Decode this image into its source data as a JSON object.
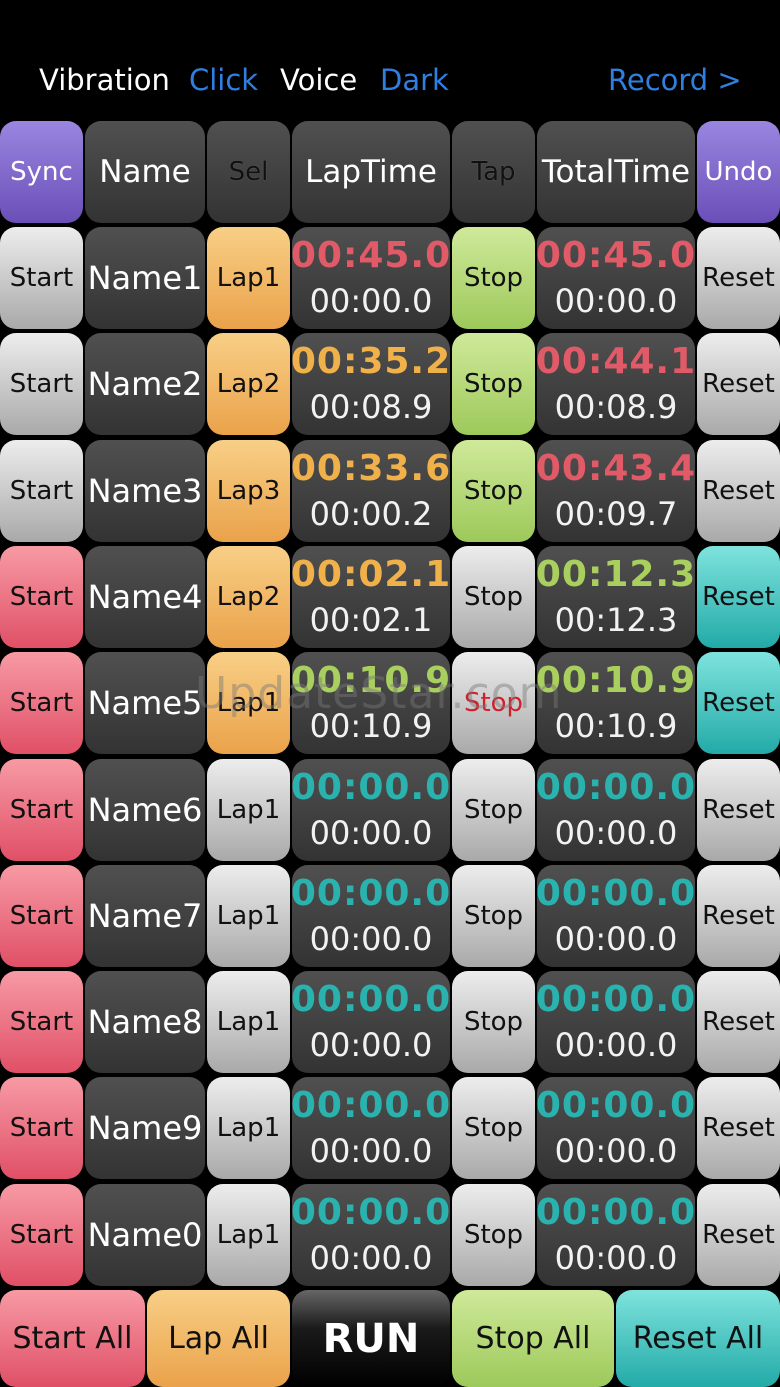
{
  "topbar": {
    "vibration": "Vibration",
    "click": "Click",
    "voice": "Voice",
    "dark": "Dark",
    "record": "Record >"
  },
  "header": {
    "sync": "Sync",
    "name": "Name",
    "sel": "Sel",
    "laptime": "LapTime",
    "tap": "Tap",
    "totaltime": "TotalTime",
    "undo": "Undo"
  },
  "colors": {
    "red_time": "#e05a68",
    "orange_time": "#f0b14a",
    "green_time": "#a9cf5e",
    "teal_time": "#2ab3ae",
    "link_blue": "#2f7fe0",
    "stop_red_text": "#d0202c"
  },
  "rows": [
    {
      "start": "Start",
      "name": "Name1",
      "lap": "Lap1",
      "lap_main": "00:45.0",
      "lap_sub": "00:00.0",
      "stop": "Stop",
      "total_main": "00:45.0",
      "total_sub": "00:00.0",
      "reset": "Reset"
    },
    {
      "start": "Start",
      "name": "Name2",
      "lap": "Lap2",
      "lap_main": "00:35.2",
      "lap_sub": "00:08.9",
      "stop": "Stop",
      "total_main": "00:44.1",
      "total_sub": "00:08.9",
      "reset": "Reset"
    },
    {
      "start": "Start",
      "name": "Name3",
      "lap": "Lap3",
      "lap_main": "00:33.6",
      "lap_sub": "00:00.2",
      "stop": "Stop",
      "total_main": "00:43.4",
      "total_sub": "00:09.7",
      "reset": "Reset"
    },
    {
      "start": "Start",
      "name": "Name4",
      "lap": "Lap2",
      "lap_main": "00:02.1",
      "lap_sub": "00:02.1",
      "stop": "Stop",
      "total_main": "00:12.3",
      "total_sub": "00:12.3",
      "reset": "Reset"
    },
    {
      "start": "Start",
      "name": "Name5",
      "lap": "Lap1",
      "lap_main": "00:10.9",
      "lap_sub": "00:10.9",
      "stop": "Stop",
      "total_main": "00:10.9",
      "total_sub": "00:10.9",
      "reset": "Reset"
    },
    {
      "start": "Start",
      "name": "Name6",
      "lap": "Lap1",
      "lap_main": "00:00.0",
      "lap_sub": "00:00.0",
      "stop": "Stop",
      "total_main": "00:00.0",
      "total_sub": "00:00.0",
      "reset": "Reset"
    },
    {
      "start": "Start",
      "name": "Name7",
      "lap": "Lap1",
      "lap_main": "00:00.0",
      "lap_sub": "00:00.0",
      "stop": "Stop",
      "total_main": "00:00.0",
      "total_sub": "00:00.0",
      "reset": "Reset"
    },
    {
      "start": "Start",
      "name": "Name8",
      "lap": "Lap1",
      "lap_main": "00:00.0",
      "lap_sub": "00:00.0",
      "stop": "Stop",
      "total_main": "00:00.0",
      "total_sub": "00:00.0",
      "reset": "Reset"
    },
    {
      "start": "Start",
      "name": "Name9",
      "lap": "Lap1",
      "lap_main": "00:00.0",
      "lap_sub": "00:00.0",
      "stop": "Stop",
      "total_main": "00:00.0",
      "total_sub": "00:00.0",
      "reset": "Reset"
    },
    {
      "start": "Start",
      "name": "Name0",
      "lap": "Lap1",
      "lap_main": "00:00.0",
      "lap_sub": "00:00.0",
      "stop": "Stop",
      "total_main": "00:00.0",
      "total_sub": "00:00.0",
      "reset": "Reset"
    }
  ],
  "bottom": {
    "start_all": "Start All",
    "lap_all": "Lap All",
    "run": "RUN",
    "stop_all": "Stop All",
    "reset_all": "Reset All"
  },
  "watermark": "UpdateStar.com"
}
